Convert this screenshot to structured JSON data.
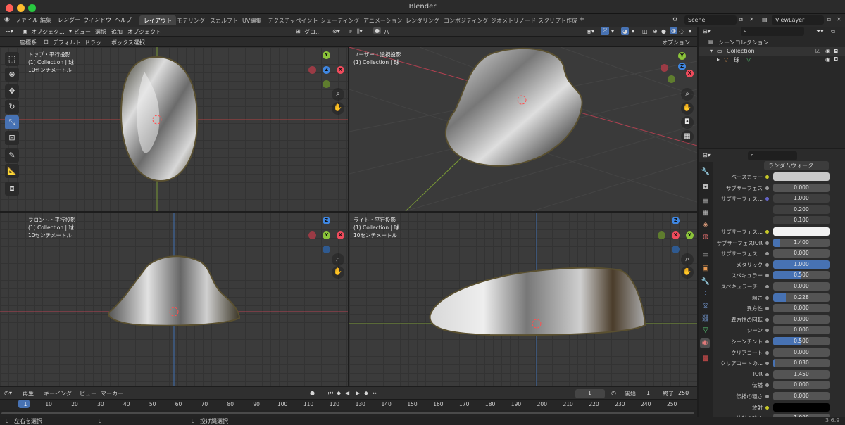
{
  "app": {
    "title": "Blender",
    "version": "3.6.9"
  },
  "menu": {
    "items": [
      "ファイル",
      "編集",
      "レンダー",
      "ウィンドウ",
      "ヘルプ"
    ]
  },
  "workspaces": [
    "レイアウト",
    "モデリング",
    "スカルプト",
    "UV編集",
    "テクスチャペイント",
    "シェーディング",
    "アニメーション",
    "レンダリング",
    "コンポジティング",
    "ジオメトリノード",
    "スクリプト作成"
  ],
  "workspace_add": "+",
  "scene": {
    "name": "Scene",
    "viewlayer": "ViewLayer"
  },
  "viewport_header": {
    "mode": "オブジェク...",
    "menus": [
      "ビュー",
      "選択",
      "追加",
      "オブジェクト"
    ],
    "orientation": "グロ...",
    "snap_label": "八",
    "coord_label": "座標系:",
    "coord_value": "デフォルト",
    "drag_label": "ドラッ...",
    "select_box": "ボックス選択",
    "options": "オプション"
  },
  "viewports": [
    {
      "title": "トップ・平行投影",
      "line2": "(1) Collection | 球",
      "line3": "10センチメートル"
    },
    {
      "title": "ユーザー・透視投影",
      "line2": "(1) Collection | 球",
      "line3": ""
    },
    {
      "title": "フロント・平行投影",
      "line2": "(1) Collection | 球",
      "line3": "10センチメートル"
    },
    {
      "title": "ライト・平行投影",
      "line2": "(1) Collection | 球",
      "line3": "10センチメートル"
    }
  ],
  "gizmo_axes": {
    "x": "X",
    "y": "Y",
    "z": "Z"
  },
  "outliner": {
    "scene_collection": "シーンコレクション",
    "collection": "Collection",
    "object": "球"
  },
  "properties": {
    "subsurface_method": "ランダムウォーク",
    "rows": [
      {
        "label": "ベースカラー",
        "value": "",
        "fill": 0,
        "type": "color",
        "color": "#c9c9c9"
      },
      {
        "label": "サブサーフェス",
        "value": "0.000",
        "fill": 0
      },
      {
        "label": "サブサーフェス...",
        "value": "1.000",
        "fill": 0
      },
      {
        "label": "",
        "value": "0.200",
        "fill": 0
      },
      {
        "label": "",
        "value": "0.100",
        "fill": 0
      },
      {
        "label": "サブサーフェス...",
        "value": "",
        "fill": 0,
        "type": "color",
        "color": "#f2f2f2"
      },
      {
        "label": "サブサーフェスIOR",
        "value": "1.400",
        "fill": 0.12
      },
      {
        "label": "サブサーフェス...",
        "value": "0.000",
        "fill": 0
      },
      {
        "label": "メタリック",
        "value": "1.000",
        "fill": 1.0
      },
      {
        "label": "スペキュラー",
        "value": "0.500",
        "fill": 0.5
      },
      {
        "label": "スペキュラーチ...",
        "value": "0.000",
        "fill": 0
      },
      {
        "label": "粗さ",
        "value": "0.228",
        "fill": 0.228
      },
      {
        "label": "異方性",
        "value": "0.000",
        "fill": 0
      },
      {
        "label": "異方性の回転",
        "value": "0.000",
        "fill": 0
      },
      {
        "label": "シーン",
        "value": "0.000",
        "fill": 0
      },
      {
        "label": "シーンチント",
        "value": "0.500",
        "fill": 0.5
      },
      {
        "label": "クリアコート",
        "value": "0.000",
        "fill": 0
      },
      {
        "label": "クリアコートの...",
        "value": "0.030",
        "fill": 0.03
      },
      {
        "label": "IOR",
        "value": "1.450",
        "fill": 0
      },
      {
        "label": "伝播",
        "value": "0.000",
        "fill": 0
      },
      {
        "label": "伝播の粗さ",
        "value": "0.000",
        "fill": 0
      },
      {
        "label": "放射",
        "value": "",
        "fill": 0,
        "type": "color",
        "color": "#000000"
      },
      {
        "label": "放射の強さ",
        "value": "1.000",
        "fill": 0
      }
    ]
  },
  "timeline": {
    "playback": "再生",
    "keying": "キーイング",
    "view": "ビュー",
    "marker": "マーカー",
    "current_frame": "1",
    "start_label": "開始",
    "start": "1",
    "end_label": "終了",
    "end": "250",
    "frames": [
      "1",
      "10",
      "20",
      "30",
      "40",
      "50",
      "60",
      "70",
      "80",
      "90",
      "100",
      "110",
      "120",
      "130",
      "140",
      "150",
      "160",
      "170",
      "180",
      "190",
      "200",
      "210",
      "220",
      "230",
      "240",
      "250"
    ]
  },
  "statusbar": {
    "left": "左右を選択",
    "middle": "投げ縄選択"
  }
}
